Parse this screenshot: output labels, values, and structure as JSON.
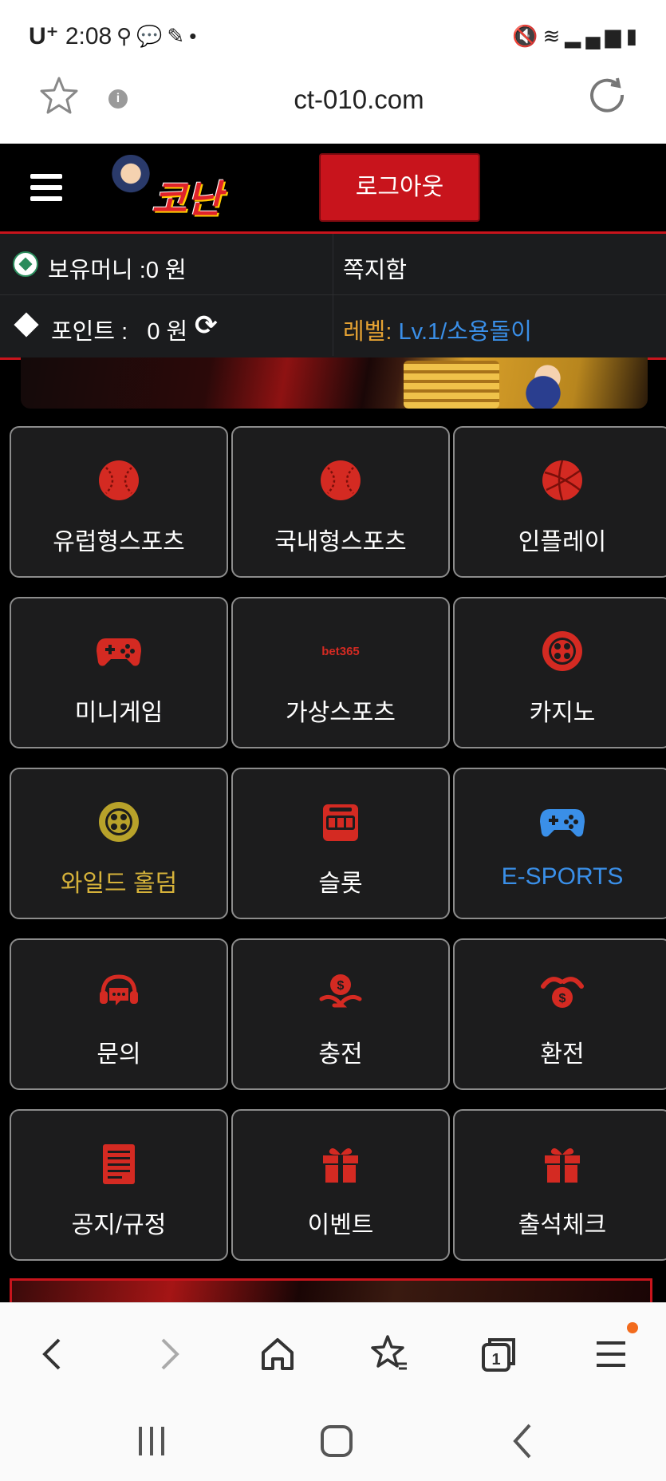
{
  "status_bar": {
    "carrier": "U⁺",
    "time": "2:08",
    "left_icons": [
      "link-icon",
      "chat-icon",
      "mute-icon",
      "dot-icon"
    ],
    "right_icons": [
      "mute-icon",
      "wifi-icon",
      "signal-icon",
      "battery-icon"
    ]
  },
  "browser": {
    "url": "ct-010.com",
    "info_glyph": "i",
    "tab_count": "1"
  },
  "header": {
    "logo_text": "코난",
    "logout_label": "로그아웃"
  },
  "account": {
    "money_label": "보유머니 :0 원",
    "message_label": "쪽지함",
    "point_label": "포인트 :   0 원",
    "level_label": "레벨: ",
    "level_value": "Lv.1/소용돌이"
  },
  "menu": {
    "tiles": [
      {
        "label": "유럽형스포츠",
        "icon": "baseball-icon"
      },
      {
        "label": "국내형스포츠",
        "icon": "baseball-icon"
      },
      {
        "label": "인플레이",
        "icon": "volleyball-icon"
      },
      {
        "label": "미니게임",
        "icon": "gamepad-icon"
      },
      {
        "label": "가상스포츠",
        "icon": "bet365-icon",
        "icon_text": "bet365"
      },
      {
        "label": "카지노",
        "icon": "casino-chip-icon"
      },
      {
        "label": "와일드 홀덤",
        "icon": "poker-chip-icon"
      },
      {
        "label": "슬롯",
        "icon": "slot-machine-icon"
      },
      {
        "label": "E-SPORTS",
        "icon": "gamepad-icon"
      },
      {
        "label": "문의",
        "icon": "headset-icon"
      },
      {
        "label": "충전",
        "icon": "deposit-icon"
      },
      {
        "label": "환전",
        "icon": "withdraw-icon"
      },
      {
        "label": "공지/규정",
        "icon": "notice-icon"
      },
      {
        "label": "이벤트",
        "icon": "gift-icon"
      },
      {
        "label": "출석체크",
        "icon": "gift-icon"
      }
    ]
  },
  "colors": {
    "accent_red": "#c8141c",
    "gold": "#d6b23a",
    "blue": "#3a8fe8",
    "level_orange": "#e5a233",
    "icon_red": "#d42a22"
  }
}
